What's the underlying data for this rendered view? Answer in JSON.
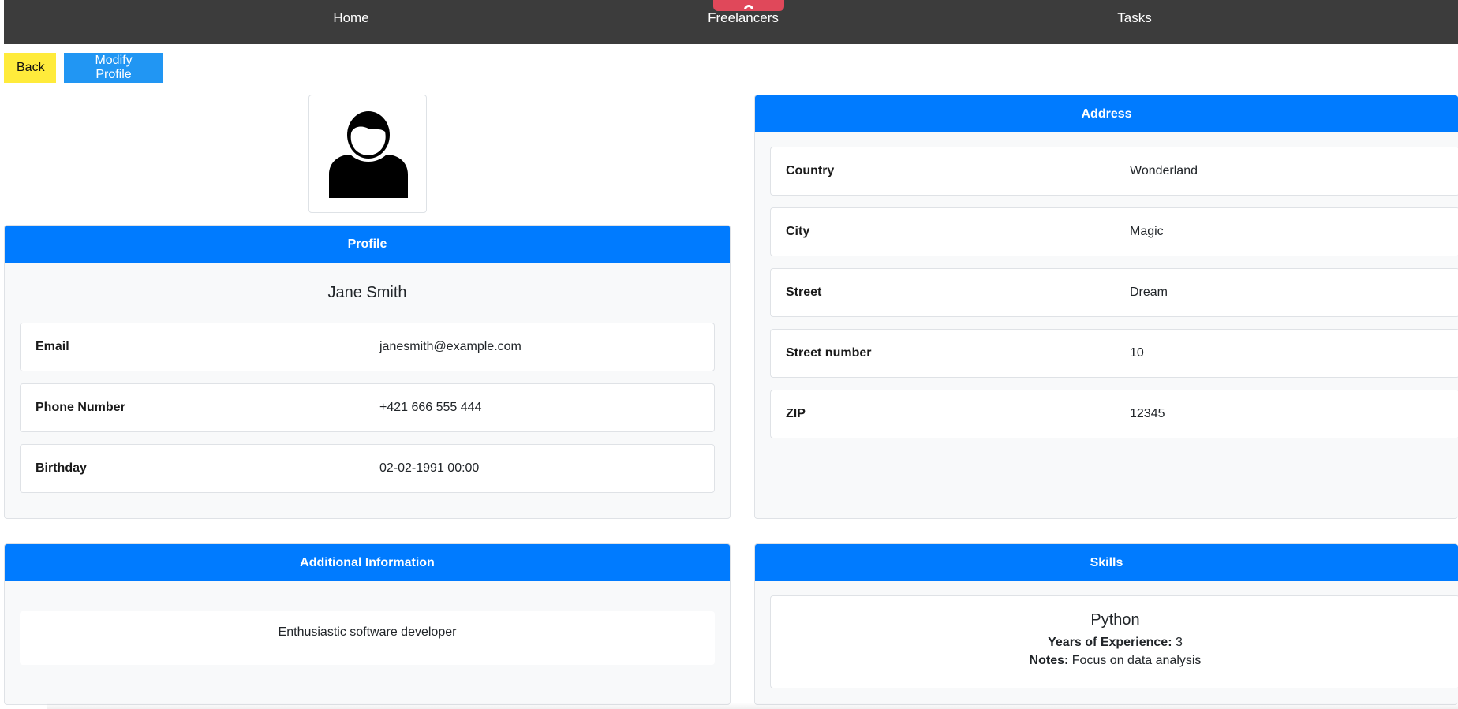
{
  "nav": {
    "items": [
      {
        "label": "Home"
      },
      {
        "label": "Freelancers"
      },
      {
        "label": "Tasks"
      }
    ]
  },
  "actions": {
    "back_label": "Back",
    "modify_label": "Modify Profile"
  },
  "avatar": {
    "icon": "user-avatar-icon"
  },
  "profile": {
    "header": "Profile",
    "name": "Jane Smith",
    "fields": [
      {
        "label": "Email",
        "value": "janesmith@example.com"
      },
      {
        "label": "Phone Number",
        "value": "+421 666 555 444"
      },
      {
        "label": "Birthday",
        "value": "02-02-1991 00:00"
      }
    ]
  },
  "address": {
    "header": "Address",
    "fields": [
      {
        "label": "Country",
        "value": "Wonderland"
      },
      {
        "label": "City",
        "value": "Magic"
      },
      {
        "label": "Street",
        "value": "Dream"
      },
      {
        "label": "Street number",
        "value": "10"
      },
      {
        "label": "ZIP",
        "value": "12345"
      }
    ]
  },
  "additional": {
    "header": "Additional Information",
    "text": "Enthusiastic software developer"
  },
  "skills": {
    "header": "Skills",
    "items": [
      {
        "name": "Python",
        "experience_label": "Years of Experience:",
        "experience_value": "3",
        "notes_label": "Notes:",
        "notes_value": "Focus on data analysis"
      }
    ]
  },
  "colors": {
    "navbar": "#3c3c3c",
    "accent": "#007bff",
    "back_button": "#ffeb3b",
    "modify_button": "#2196f3",
    "badge": "#e0485a"
  }
}
